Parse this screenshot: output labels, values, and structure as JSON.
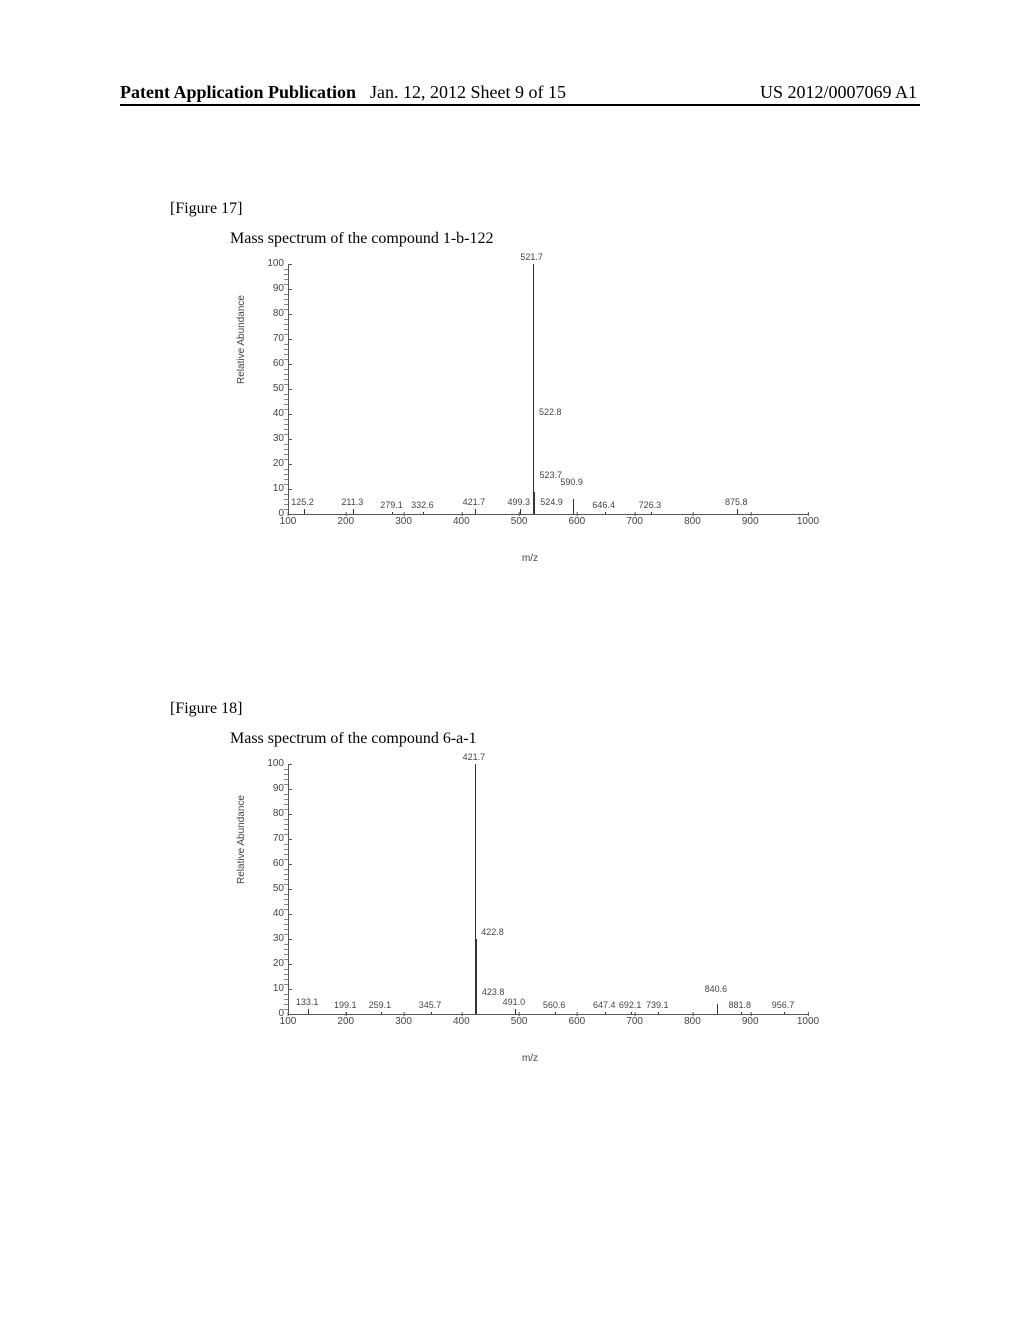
{
  "header": {
    "left": "Patent Application Publication",
    "mid": "Jan. 12, 2012  Sheet 9 of 15",
    "right": "US 2012/0007069 A1"
  },
  "figures": [
    {
      "label": "[Figure 17]",
      "title": "Mass spectrum of the compound 1-b-122"
    },
    {
      "label": "[Figure 18]",
      "title": "Mass spectrum of the compound 6-a-1"
    }
  ],
  "axis": {
    "ylabel": "Relative Abundance",
    "xlabel": "m/z",
    "yticks": [
      0,
      10,
      20,
      30,
      40,
      50,
      60,
      70,
      80,
      90,
      100
    ],
    "xticks": [
      100,
      200,
      300,
      400,
      500,
      600,
      700,
      800,
      900,
      1000
    ]
  },
  "chart_data": [
    {
      "type": "bar",
      "title": "Mass spectrum of the compound 1-b-122",
      "xlabel": "m/z",
      "ylabel": "Relative Abundance",
      "xlim": [
        100,
        1000
      ],
      "ylim": [
        0,
        100
      ],
      "peaks": [
        {
          "mz": 125.2,
          "ra": 2,
          "label": "125.2",
          "dy": 0
        },
        {
          "mz": 211.3,
          "ra": 2,
          "label": "211.3",
          "dy": 0
        },
        {
          "mz": 279.1,
          "ra": 1,
          "label": "279.1",
          "dy": 0
        },
        {
          "mz": 332.6,
          "ra": 1,
          "label": "332.6",
          "dy": 0
        },
        {
          "mz": 421.7,
          "ra": 2,
          "label": "421.7",
          "dy": 0
        },
        {
          "mz": 499.3,
          "ra": 2,
          "label": "499.3",
          "dy": 0
        },
        {
          "mz": 521.7,
          "ra": 100,
          "label": "521.7",
          "dy": 0
        },
        {
          "mz": 522.8,
          "ra": 38,
          "label": "522.8",
          "dy": 0,
          "dx": 18
        },
        {
          "mz": 523.7,
          "ra": 9,
          "label": "523.7",
          "dy": -10,
          "dx": 18
        },
        {
          "mz": 524.9,
          "ra": 2,
          "label": "524.9",
          "dy": 0,
          "dx": 18
        },
        {
          "mz": 590.9,
          "ra": 6,
          "label": "590.9",
          "dy": -10
        },
        {
          "mz": 646.4,
          "ra": 1,
          "label": "646.4",
          "dy": 0
        },
        {
          "mz": 726.3,
          "ra": 1,
          "label": "726.3",
          "dy": 0
        },
        {
          "mz": 875.8,
          "ra": 2,
          "label": "875.8",
          "dy": 0
        }
      ]
    },
    {
      "type": "bar",
      "title": "Mass spectrum of the compound 6-a-1",
      "xlabel": "m/z",
      "ylabel": "Relative Abundance",
      "xlim": [
        100,
        1000
      ],
      "ylim": [
        0,
        100
      ],
      "peaks": [
        {
          "mz": 133.1,
          "ra": 2,
          "label": "133.1",
          "dy": 0
        },
        {
          "mz": 199.1,
          "ra": 1,
          "label": "199.1",
          "dy": 0
        },
        {
          "mz": 259.1,
          "ra": 1,
          "label": "259.1",
          "dy": 0
        },
        {
          "mz": 345.7,
          "ra": 1,
          "label": "345.7",
          "dy": 0
        },
        {
          "mz": 421.7,
          "ra": 100,
          "label": "421.7",
          "dy": 0
        },
        {
          "mz": 422.8,
          "ra": 30,
          "label": "422.8",
          "dy": 0,
          "dx": 18
        },
        {
          "mz": 423.8,
          "ra": 6,
          "label": "423.8",
          "dy": 0,
          "dx": 18
        },
        {
          "mz": 491.0,
          "ra": 2,
          "label": "491.0",
          "dy": 0
        },
        {
          "mz": 560.6,
          "ra": 1,
          "label": "560.6",
          "dy": 0
        },
        {
          "mz": 647.4,
          "ra": 1,
          "label": "647.4",
          "dy": 0
        },
        {
          "mz": 692.1,
          "ra": 1,
          "label": "692.1",
          "dy": 0
        },
        {
          "mz": 739.1,
          "ra": 1,
          "label": "739.1",
          "dy": 0
        },
        {
          "mz": 840.6,
          "ra": 4,
          "label": "840.6",
          "dy": -8
        },
        {
          "mz": 881.8,
          "ra": 1,
          "label": "881.8",
          "dy": 0
        },
        {
          "mz": 956.7,
          "ra": 1,
          "label": "956.7",
          "dy": 0
        }
      ]
    }
  ]
}
